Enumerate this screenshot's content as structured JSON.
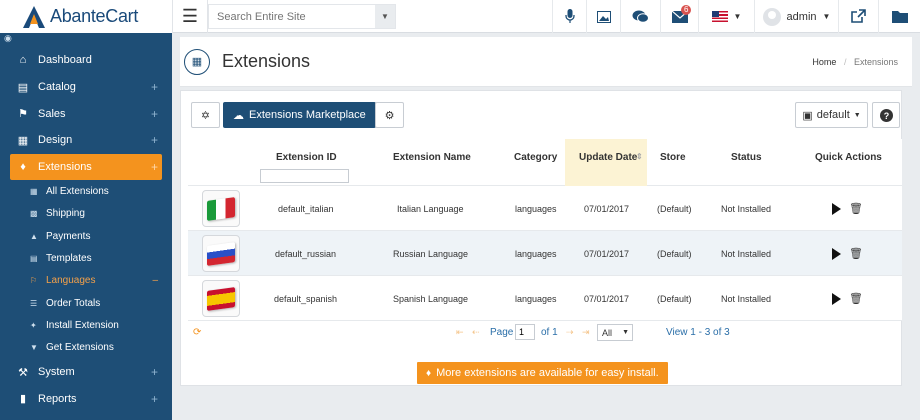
{
  "app": {
    "name": "AbanteCart"
  },
  "topbar": {
    "search_placeholder": "Search Entire Site",
    "message_count": "6",
    "user_name": "admin"
  },
  "sidebar": {
    "items": [
      {
        "label": "Dashboard",
        "icon": "home-icon"
      },
      {
        "label": "Catalog",
        "icon": "folder-icon"
      },
      {
        "label": "Sales",
        "icon": "flag-icon"
      },
      {
        "label": "Design",
        "icon": "file-icon"
      },
      {
        "label": "Extensions",
        "icon": "puzzle-icon"
      },
      {
        "label": "System",
        "icon": "wrench-icon"
      },
      {
        "label": "Reports",
        "icon": "chart-icon"
      }
    ],
    "extension_subitems": [
      {
        "label": "All Extensions",
        "icon": "grid-icon"
      },
      {
        "label": "Shipping",
        "icon": "truck-icon"
      },
      {
        "label": "Payments",
        "icon": "bank-icon"
      },
      {
        "label": "Templates",
        "icon": "template-icon"
      },
      {
        "label": "Languages",
        "icon": "language-icon"
      },
      {
        "label": "Order Totals",
        "icon": "list-icon"
      },
      {
        "label": "Install Extension",
        "icon": "wand-icon"
      },
      {
        "label": "Get Extensions",
        "icon": "download-icon"
      }
    ],
    "accent_color": "#f4931e",
    "background_color": "#1e4e76"
  },
  "page": {
    "title": "Extensions",
    "breadcrumb_home": "Home",
    "breadcrumb_current": "Extensions"
  },
  "toolbar": {
    "marketplace_label": "Extensions Marketplace",
    "store_select": "default"
  },
  "grid": {
    "columns": [
      "Extension ID",
      "Extension Name",
      "Category",
      "Update Date",
      "Store",
      "Status",
      "Quick Actions"
    ],
    "rows": [
      {
        "flag": "italian",
        "id": "default_italian",
        "name": "Italian Language",
        "category": "languages",
        "date": "07/01/2017",
        "store": "(Default)",
        "status": "Not Installed"
      },
      {
        "flag": "russian",
        "id": "default_russian",
        "name": "Russian Language",
        "category": "languages",
        "date": "07/01/2017",
        "store": "(Default)",
        "status": "Not Installed"
      },
      {
        "flag": "spanish",
        "id": "default_spanish",
        "name": "Spanish Language",
        "category": "languages",
        "date": "07/01/2017",
        "store": "(Default)",
        "status": "Not Installed"
      }
    ]
  },
  "pager": {
    "page_label": "Page",
    "page_value": "1",
    "of_label": "of 1",
    "rows_option": "All",
    "view_text": "View 1 - 3 of 3"
  },
  "cta": {
    "label": "More extensions are available for easy install."
  }
}
